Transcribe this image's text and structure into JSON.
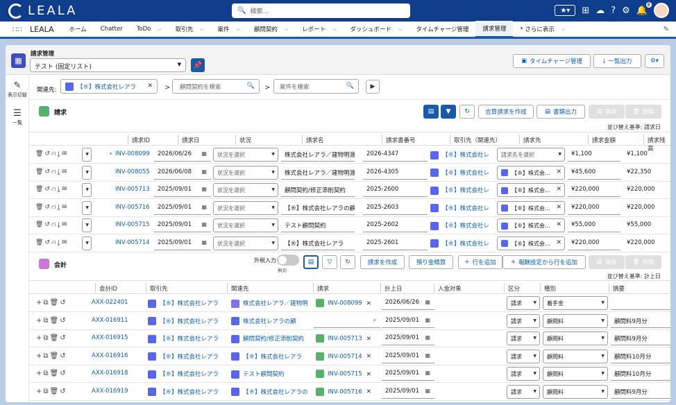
{
  "brand": {
    "logo_text": "LEALA"
  },
  "search": {
    "placeholder": "検索..."
  },
  "topbar": {
    "notif_count": "8"
  },
  "nav": {
    "app_name": "LEALA",
    "items": [
      {
        "label": "ホーム",
        "chev": false
      },
      {
        "label": "Chatter",
        "chev": false
      },
      {
        "label": "ToDo",
        "chev": true
      },
      {
        "label": "取引先",
        "chev": true
      },
      {
        "label": "案件",
        "chev": true
      },
      {
        "label": "顧問契約",
        "chev": true
      },
      {
        "label": "レポート",
        "chev": true
      },
      {
        "label": "ダッシュボード",
        "chev": true
      },
      {
        "label": "タイムチャージ管理",
        "chev": false
      },
      {
        "label": "請求管理",
        "chev": false,
        "active": true
      },
      {
        "label": "* さらに表示",
        "chev": true
      }
    ]
  },
  "page": {
    "title": "請求管理",
    "list_view": "テスト (固定リスト)",
    "time_charge_btn": "タイムチャージ管理",
    "export_btn": "一覧出力"
  },
  "side": {
    "toggle_label": "表示切替",
    "list_label": "一覧"
  },
  "filter": {
    "label": "関連先:",
    "account": "【®】株式会社レアラ",
    "contract_placeholder": "顧問契約を検索",
    "matter_placeholder": "案件を検索"
  },
  "invoice": {
    "title": "請求",
    "merge_btn": "合算請求を作成",
    "doc_btn": "書類出力",
    "save_btn": "保存",
    "delete_btn": "削除",
    "sort_label": "並び替え基準: 請求日",
    "headers": [
      "請求ID",
      "請求日",
      "状況",
      "請求名",
      "請求書番号",
      "取引先（関連先）",
      "請求先",
      "請求金額",
      "請求残高"
    ],
    "rows": [
      {
        "id": "INV-008099",
        "date": "2026/06/26",
        "status": "状況を選択",
        "name": "株式会社レアラ／建物明渡",
        "number": "2026-4347",
        "account": "【®】株式会社レ",
        "billto": "請求先を選択",
        "billto_select": true,
        "amount": "¥1,100",
        "balance": "¥1,100",
        "expand": true
      },
      {
        "id": "INV-008055",
        "date": "2026/06/08",
        "status": "状況を選択",
        "name": "株式会社レアラ／建物明渡",
        "number": "2026-4305",
        "account": "【®】株式会社レ",
        "billto": "【®】株式会...",
        "billto_select": false,
        "amount": "¥45,600",
        "balance": "¥22,350"
      },
      {
        "id": "INV-005713",
        "date": "2025/09/01",
        "status": "状況を選択",
        "name": "顧問契約/修正添削契約",
        "number": "2025-2600",
        "account": "【®】株式会社レ",
        "billto": "【®】株式会...",
        "billto_select": false,
        "amount": "¥220,000",
        "balance": "¥220,000"
      },
      {
        "id": "INV-005716",
        "date": "2025/09/01",
        "status": "状況を選択",
        "name": "【®】株式会社レアラの顧",
        "number": "2025-2603",
        "account": "【®】株式会社レ",
        "billto": "【®】株式会...",
        "billto_select": false,
        "amount": "¥220,000",
        "balance": "¥220,000"
      },
      {
        "id": "INV-005715",
        "date": "2025/09/01",
        "status": "状況を選択",
        "name": "テスト顧問契約",
        "number": "2025-2602",
        "account": "【®】株式会社レ",
        "billto": "【®】株式会...",
        "billto_select": false,
        "amount": "¥55,000",
        "balance": "¥55,000"
      },
      {
        "id": "INV-005714",
        "date": "2025/09/01",
        "status": "状況を選択",
        "name": "【®】株式会社レアラ",
        "number": "2025-2601",
        "account": "【®】株式会社レ",
        "billto": "【®】株式会...",
        "billto_select": false,
        "amount": "¥220,000",
        "balance": "¥220,000"
      }
    ]
  },
  "accounting": {
    "title": "会計",
    "tax_label": "外税入力",
    "tax_state": "無効",
    "create_invoice_btn": "請求を作成",
    "deposit_btn": "預り金精算",
    "add_row_btn": "行を追加",
    "add_from_fee_btn": "報酬設定から行を追加",
    "save_btn": "保存",
    "delete_btn": "削除",
    "sort_label": "並び替え基準: 計上日",
    "headers": [
      "会計ID",
      "取引先",
      "関連先",
      "請求",
      "計上日",
      "入金対象",
      "区分",
      "種別",
      "摘要"
    ],
    "rows": [
      {
        "id": "AXX-022401",
        "account": "【®】株式会社レアラ",
        "related": "株式会社レアラ／建物明",
        "related_color": "#7c74e6",
        "invoice": "INV-008099",
        "date": "2026/06/26",
        "kubun": "請求",
        "kind": "着手金",
        "memo": ""
      },
      {
        "id": "AXX-016911",
        "account": "【®】株式会社レアラ",
        "related": "株式会社レアラの顧",
        "related_color": "#5867e8",
        "invoice": "",
        "date": "2025/09/01",
        "kubun": "請求",
        "kind": "顧問料",
        "memo": "顧問料9月分"
      },
      {
        "id": "AXX-016915",
        "account": "【®】株式会社レアラ",
        "related": "顧問契約/修正添削契約",
        "related_color": "#5867e8",
        "invoice": "INV-005713",
        "date": "2025/09/01",
        "kubun": "請求",
        "kind": "顧問料",
        "memo": "顧問料9月分"
      },
      {
        "id": "AXX-016916",
        "account": "【®】株式会社レアラ",
        "related": "【®】株式会社レアラ",
        "related_color": "#5867e8",
        "invoice": "INV-005714",
        "date": "2025/09/01",
        "kubun": "請求",
        "kind": "顧問料",
        "memo": "顧問料10月分"
      },
      {
        "id": "AXX-016918",
        "account": "【®】株式会社レアラ",
        "related": "テスト顧問契約",
        "related_color": "#5867e8",
        "invoice": "INV-005715",
        "date": "2025/09/01",
        "kubun": "請求",
        "kind": "顧問料",
        "memo": "顧問料10月分"
      },
      {
        "id": "AXX-016919",
        "account": "【®】株式会社レアラ",
        "related": "【®】株式会社レアラの",
        "related_color": "#5867e8",
        "invoice": "INV-005716",
        "date": "2025/09/01",
        "kubun": "請求",
        "kind": "顧問料",
        "memo": "顧問料9月分"
      }
    ]
  }
}
